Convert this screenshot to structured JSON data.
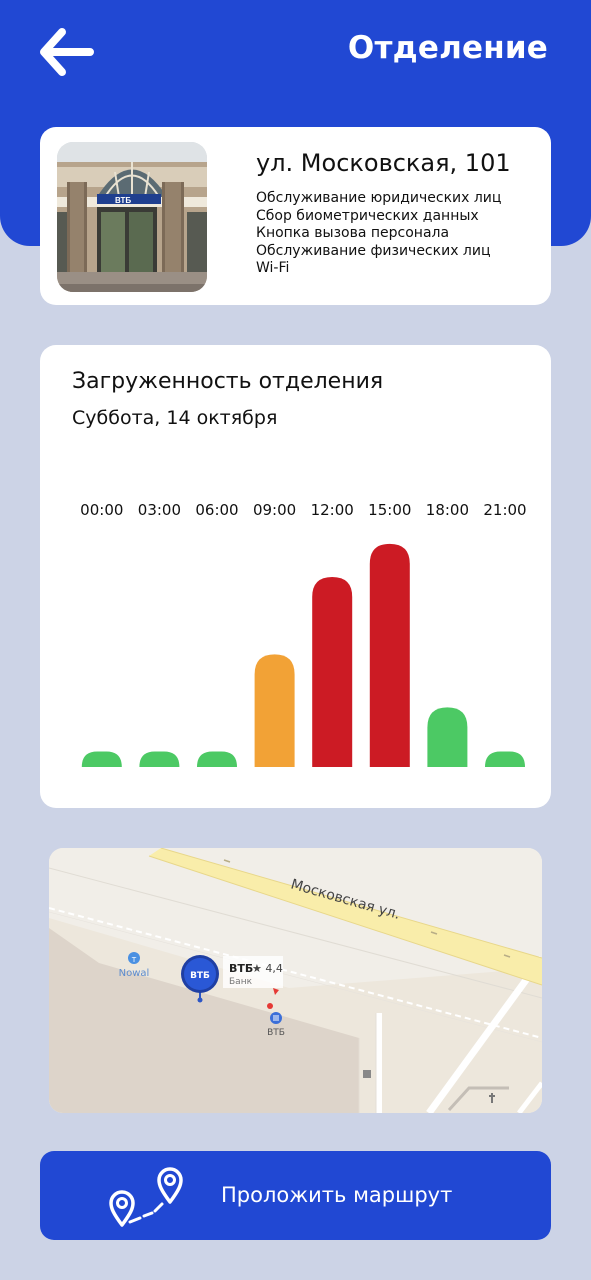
{
  "header": {
    "title": "Отделение",
    "back_icon": "arrow-left-icon",
    "bg_color": "#2148d3"
  },
  "branch": {
    "address": "ул. Московская, 101",
    "photo_sign_text": "ВТБ",
    "services": [
      "Обслуживание юридических лиц",
      "Сбор биометрических данных",
      "Кнопка вызова персонала",
      "Обслуживание физических лиц",
      "Wi-Fi"
    ]
  },
  "load": {
    "title": "Загруженность отделения",
    "date": "Суббота, 14 октября"
  },
  "chart_data": {
    "type": "bar",
    "categories": [
      "00:00",
      "03:00",
      "06:00",
      "09:00",
      "12:00",
      "15:00",
      "18:00",
      "21:00"
    ],
    "values": [
      7,
      7,
      7,
      51,
      86,
      101,
      27,
      7
    ],
    "levels": [
      "low",
      "low",
      "low",
      "medium",
      "high",
      "high",
      "low",
      "low"
    ],
    "colors": {
      "low": "#4cc964",
      "medium": "#f2a236",
      "high": "#cc1b24"
    },
    "ylim": [
      0,
      105
    ],
    "grid": false,
    "title": "",
    "xlabel": "",
    "ylabel": ""
  },
  "map": {
    "street_label": "Московская ул.",
    "poi_nowal": "Nowal",
    "marker_logo": "ВТБ",
    "bank_name": "ВТБ",
    "rating": "★ 4,4",
    "category": "Банк",
    "atm_label": "ВТБ"
  },
  "route_button": {
    "label": "Проложить маршрут",
    "icon": "route-pins-icon"
  }
}
